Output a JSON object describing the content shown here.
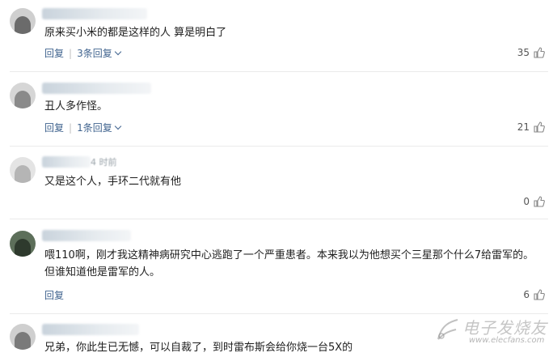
{
  "comments": [
    {
      "text": "原来买小米的都是这样的人 算是明白了",
      "reply_label": "回复",
      "replies_label": "3条回复",
      "likes": "35"
    },
    {
      "text": "丑人多作怪。",
      "reply_label": "回复",
      "replies_label": "1条回复",
      "likes": "21"
    },
    {
      "name_fragment": "4 时前",
      "text": "又是这个人，手环二代就有他",
      "likes": "0"
    },
    {
      "text": "喂110啊，刚才我这精神病研究中心逃跑了一个严重患者。本来我以为他想买个三星那个什么7给雷军的。但谁知道他是雷军的人。",
      "reply_label": "回复",
      "likes": "6"
    },
    {
      "text": "兄弟，你此生已无憾，可以自裁了，到时雷布斯会给你烧一台5X的"
    }
  ],
  "watermark": {
    "cn": "电子发烧友",
    "en": "www.elecfans.com"
  },
  "colors": {
    "link": "#41648f",
    "divider": "#ebebeb",
    "text": "#1e1e1e"
  }
}
